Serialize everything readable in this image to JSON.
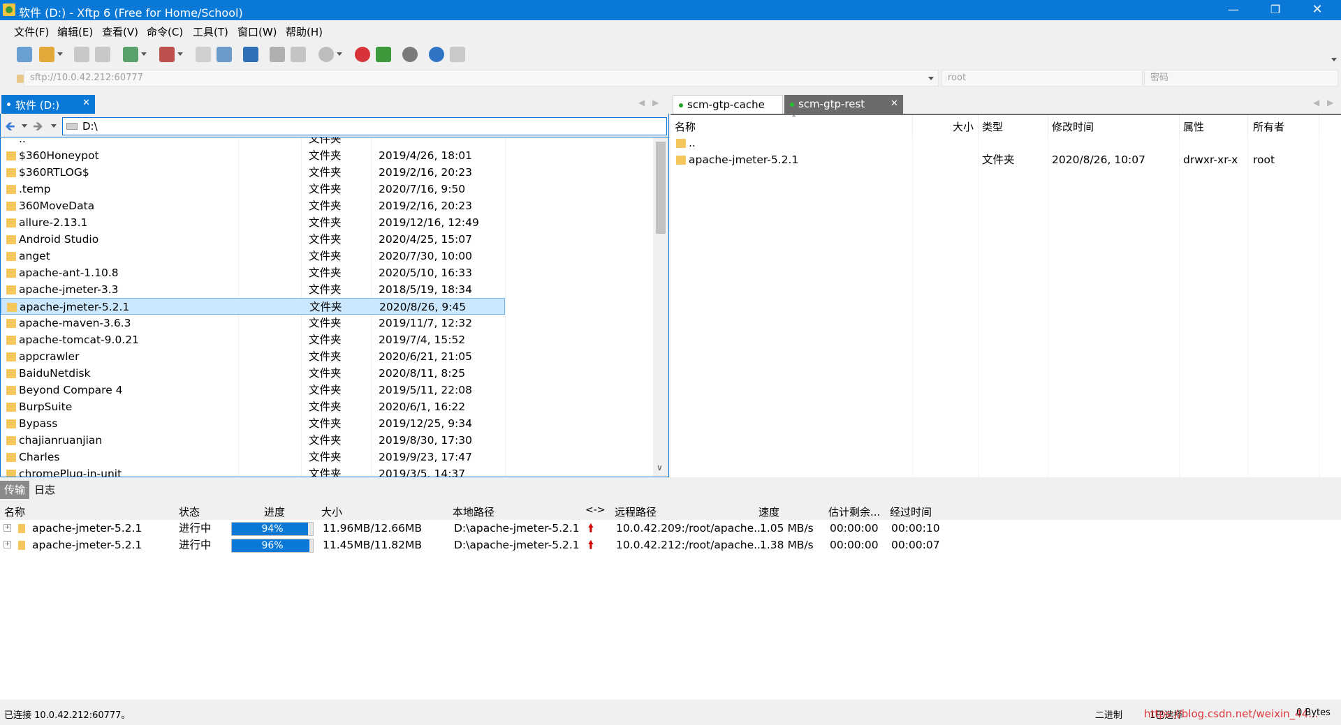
{
  "window": {
    "title": "软件 (D:) - Xftp 6 (Free for Home/School)"
  },
  "menu": [
    "文件(F)",
    "编辑(E)",
    "查看(V)",
    "命令(C)",
    "工具(T)",
    "窗口(W)",
    "帮助(H)"
  ],
  "address": {
    "url_placeholder": "sftp://10.0.42.212:60777",
    "user_placeholder": "root",
    "password_placeholder": "密码"
  },
  "left_pane": {
    "tab_label": "软件 (D:)",
    "path": "D:\\",
    "parent_type": "文件夹",
    "files": [
      {
        "name": "$360Honeypot",
        "type": "文件夹",
        "date": "2019/4/26, 18:01"
      },
      {
        "name": "$360RTLOG$",
        "type": "文件夹",
        "date": "2019/2/16, 20:23"
      },
      {
        "name": ".temp",
        "type": "文件夹",
        "date": "2020/7/16, 9:50"
      },
      {
        "name": "360MoveData",
        "type": "文件夹",
        "date": "2019/2/16, 20:23"
      },
      {
        "name": "allure-2.13.1",
        "type": "文件夹",
        "date": "2019/12/16, 12:49"
      },
      {
        "name": "Android Studio",
        "type": "文件夹",
        "date": "2020/4/25, 15:07"
      },
      {
        "name": "anget",
        "type": "文件夹",
        "date": "2020/7/30, 10:00"
      },
      {
        "name": "apache-ant-1.10.8",
        "type": "文件夹",
        "date": "2020/5/10, 16:33"
      },
      {
        "name": "apache-jmeter-3.3",
        "type": "文件夹",
        "date": "2018/5/19, 18:34"
      },
      {
        "name": "apache-jmeter-5.2.1",
        "type": "文件夹",
        "date": "2020/8/26, 9:45"
      },
      {
        "name": "apache-maven-3.6.3",
        "type": "文件夹",
        "date": "2019/11/7, 12:32"
      },
      {
        "name": "apache-tomcat-9.0.21",
        "type": "文件夹",
        "date": "2019/7/4, 15:52"
      },
      {
        "name": "appcrawler",
        "type": "文件夹",
        "date": "2020/6/21, 21:05"
      },
      {
        "name": "BaiduNetdisk",
        "type": "文件夹",
        "date": "2020/8/11, 8:25"
      },
      {
        "name": "Beyond Compare 4",
        "type": "文件夹",
        "date": "2019/5/11, 22:08"
      },
      {
        "name": "BurpSuite",
        "type": "文件夹",
        "date": "2020/6/1, 16:22"
      },
      {
        "name": "Bypass",
        "type": "文件夹",
        "date": "2019/12/25, 9:34"
      },
      {
        "name": "chajianruanjian",
        "type": "文件夹",
        "date": "2019/8/30, 17:30"
      },
      {
        "name": "Charles",
        "type": "文件夹",
        "date": "2019/9/23, 17:47"
      },
      {
        "name": "chromePlug-in-unit",
        "type": "文件夹",
        "date": "2019/3/5, 14:37"
      }
    ]
  },
  "right_pane": {
    "tabs": [
      "scm-gtp-cache",
      "scm-gtp-rest"
    ],
    "columns": [
      "名称",
      "大小",
      "类型",
      "修改时间",
      "属性",
      "所有者"
    ],
    "parent_label": "..",
    "files": [
      {
        "name": "apache-jmeter-5.2.1",
        "size": "",
        "type": "文件夹",
        "modified": "2020/8/26, 10:07",
        "perms": "drwxr-xr-x",
        "owner": "root"
      }
    ]
  },
  "bottom": {
    "tabs": [
      "传输",
      "日志"
    ],
    "columns": [
      "名称",
      "状态",
      "进度",
      "大小",
      "本地路径",
      "<->",
      "远程路径",
      "速度",
      "估计剩余...",
      "经过时间"
    ],
    "transfers": [
      {
        "name": "apache-jmeter-5.2.1",
        "status": "进行中",
        "progress_label": "94%",
        "progress": 94,
        "size": "11.96MB/12.66MB",
        "local": "D:\\apache-jmeter-5.2.1",
        "remote": "10.0.42.209:/root/apache...",
        "speed": "1.05 MB/s",
        "remaining": "00:00:00",
        "elapsed": "00:00:10"
      },
      {
        "name": "apache-jmeter-5.2.1",
        "status": "进行中",
        "progress_label": "96%",
        "progress": 96,
        "size": "11.45MB/11.82MB",
        "local": "D:\\apache-jmeter-5.2.1",
        "remote": "10.0.42.212:/root/apache...",
        "speed": "1.38 MB/s",
        "remaining": "00:00:00",
        "elapsed": "00:00:07"
      }
    ]
  },
  "status": {
    "connected": "已连接 10.0.42.212:60777。",
    "mode": "二进制",
    "selected": "1已选择",
    "watermark": "https://blog.csdn.net/weixin_44...",
    "bytes": "0 Bytes"
  },
  "colors": {
    "accent": "#0a78d7",
    "selection": "#cce8ff",
    "folder": "#f5c65c",
    "upload_arrow": "#d40000",
    "watermark": "#e0383f"
  },
  "icons": [
    "new-session-icon",
    "open-folder-icon",
    "connect-icon",
    "disconnect-icon",
    "new-tab-icon",
    "play-icon",
    "copy-icon",
    "paste-icon",
    "transfer-icon",
    "stop-icon",
    "xshell-icon",
    "xftp-icon",
    "gear-icon",
    "help-icon",
    "chat-icon"
  ]
}
